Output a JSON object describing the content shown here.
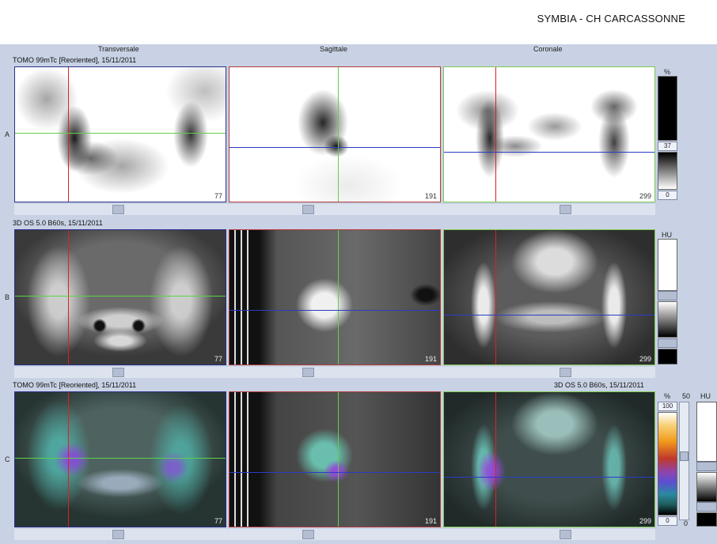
{
  "header": {
    "title": "SYMBIA - CH CARCASSONNE"
  },
  "columns": {
    "transverse": "Transversale",
    "sagittal": "Sagittale",
    "coronal": "Coronale"
  },
  "rows": {
    "a": {
      "label": "A",
      "caption": "TOMO 99mTc [Reoriented], 15/11/2011",
      "panes": {
        "transverse": "77",
        "sagittal": "191",
        "coronal": "299"
      },
      "scale": {
        "unit": "%",
        "top_value": "37",
        "bottom_value": "0"
      }
    },
    "b": {
      "label": "B",
      "caption": "3D  OS  5.0  B60s, 15/11/2011",
      "panes": {
        "transverse": "77",
        "sagittal": "191",
        "coronal": "299"
      },
      "scale": {
        "unit": "HU"
      }
    },
    "c": {
      "label": "C",
      "caption_left": "TOMO 99mTc [Reoriented], 15/11/2011",
      "caption_right": "3D  OS  5.0  B60s, 15/11/2011",
      "panes": {
        "transverse": "77",
        "sagittal": "191",
        "coronal": "299"
      },
      "scale_pet": {
        "unit": "%",
        "top_value": "100",
        "bottom_value": "0"
      },
      "blend": {
        "top_value": "50",
        "bottom_value": "0"
      },
      "scale_ct": {
        "unit": "HU"
      }
    }
  },
  "colors": {
    "transverse_border": "#2a2f8a",
    "sagittal_border": "#b03a3a",
    "coronal_border": "#7ec850",
    "crosshair_red": "#e02020",
    "crosshair_green": "#5fd04a",
    "crosshair_blue": "#2a3cc8"
  }
}
